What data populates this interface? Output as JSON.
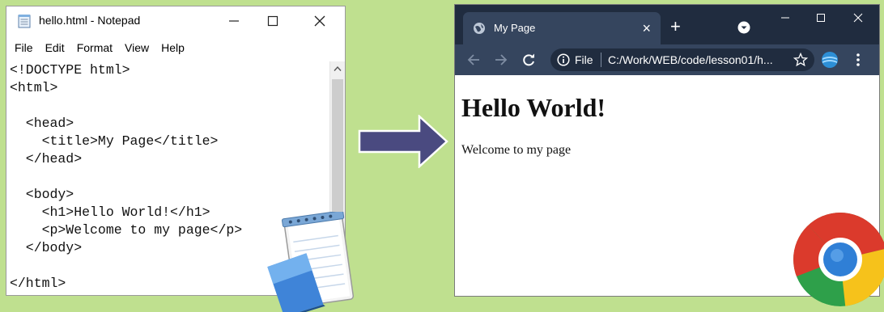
{
  "notepad": {
    "title": "hello.html - Notepad",
    "menu": [
      "File",
      "Edit",
      "Format",
      "View",
      "Help"
    ],
    "code_lines": [
      "<!DOCTYPE html>",
      "<html>",
      "",
      "  <head>",
      "    <title>My Page</title>",
      "  </head>",
      "",
      "  <body>",
      "    <h1>Hello World!</h1>",
      "    <p>Welcome to my page</p>",
      "  </body>",
      "",
      "</html>"
    ]
  },
  "browser": {
    "tab_title": "My Page",
    "tab_close": "×",
    "new_tab": "+",
    "scheme_label": "File",
    "url": "C:/Work/WEB/code/lesson01/h...",
    "page": {
      "heading": "Hello World!",
      "paragraph": "Welcome to my page"
    }
  },
  "colors": {
    "background": "#bfe08f",
    "arrow": "#4a4a80",
    "browser_dark": "#202c3f",
    "browser_toolbar": "#35455e"
  },
  "icons": {
    "notepad": [
      "notepad-doc-icon",
      "minimize-icon",
      "maximize-icon",
      "close-icon",
      "scroll-up-icon",
      "notepad-app-icon"
    ],
    "browser": [
      "globe-icon",
      "tab-search-icon",
      "back-icon",
      "forward-icon",
      "reload-icon",
      "info-icon",
      "star-icon",
      "extension-icon",
      "menu-dots-icon",
      "chrome-logo-icon"
    ]
  }
}
